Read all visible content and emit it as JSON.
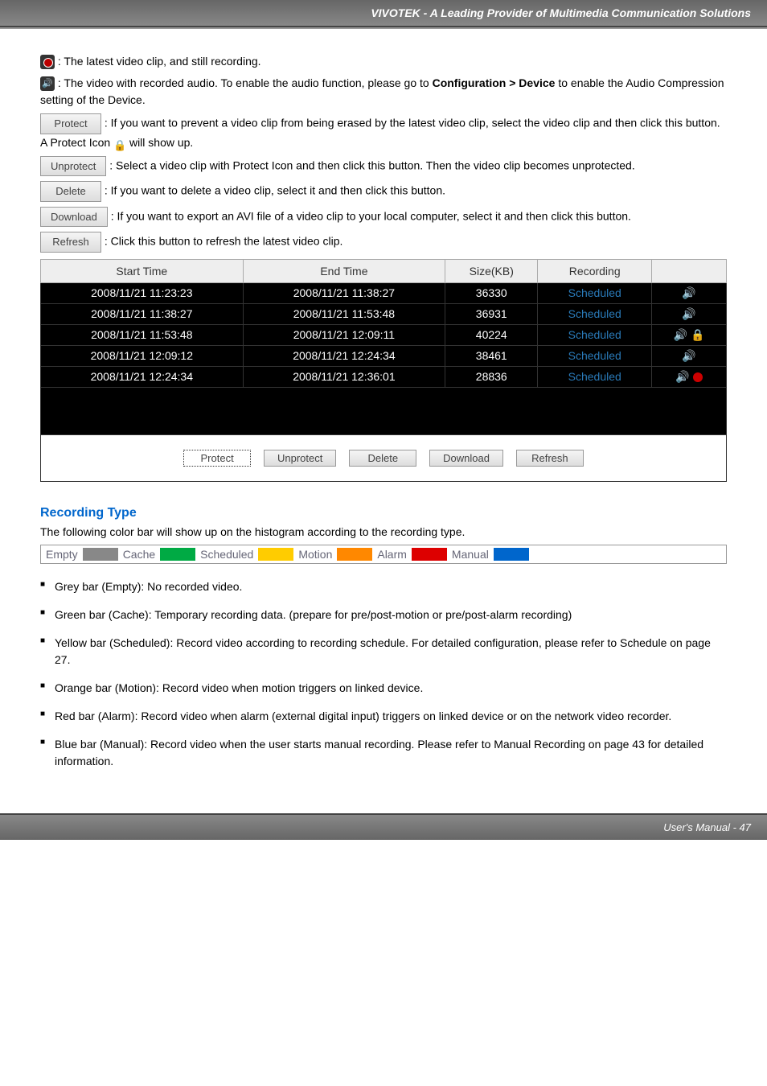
{
  "header": {
    "title": "VIVOTEK - A Leading Provider of Multimedia Communication Solutions"
  },
  "intro": {
    "rec": ": The latest video clip, and still recording.",
    "audio_a": " : The video with recorded audio. To enable the audio function, please go to ",
    "audio_b": "Configuration > Device",
    "audio_c": " to enable the Audio Compression setting of the Device."
  },
  "buttons": {
    "protect": "Protect",
    "unprotect": "Unprotect",
    "delete": "Delete",
    "download": "Download",
    "refresh": "Refresh"
  },
  "desc": {
    "protect_a": ":  If you want to prevent a video clip from being erased by the latest video clip, select the video clip and then click this button. A Protect Icon ",
    "protect_b": " will show up.",
    "unprotect": ": Select a video clip with Protect Icon and then click this button. Then the video clip becomes unprotected.",
    "delete": ": If you want to delete a video clip, select it and then click this button.",
    "download": ": If you want to export an AVI file of a video clip to your local computer, select it and then click this button.",
    "refresh": ": Click this button to refresh the latest video clip."
  },
  "table": {
    "headers": [
      "Start Time",
      "End Time",
      "Size(KB)",
      "Recording",
      ""
    ],
    "rows": [
      {
        "start": "2008/11/21 11:23:23",
        "end": "2008/11/21 11:38:27",
        "size": "36330",
        "rec": "Scheduled",
        "icons": "spk"
      },
      {
        "start": "2008/11/21 11:38:27",
        "end": "2008/11/21 11:53:48",
        "size": "36931",
        "rec": "Scheduled",
        "icons": "spk"
      },
      {
        "start": "2008/11/21 11:53:48",
        "end": "2008/11/21 12:09:11",
        "size": "40224",
        "rec": "Scheduled",
        "icons": "spklock"
      },
      {
        "start": "2008/11/21 12:09:12",
        "end": "2008/11/21 12:24:34",
        "size": "38461",
        "rec": "Scheduled",
        "icons": "spk"
      },
      {
        "start": "2008/11/21 12:24:34",
        "end": "2008/11/21 12:36:01",
        "size": "28836",
        "rec": "Scheduled",
        "icons": "spkrec"
      }
    ]
  },
  "rectype": {
    "title": "Recording Type",
    "intro": "The following color bar will show up on the histogram according to the recording type.",
    "legend": {
      "empty": "Empty",
      "cache": "Cache",
      "scheduled": "Scheduled",
      "motion": "Motion",
      "alarm": "Alarm",
      "manual": "Manual"
    }
  },
  "bullets": {
    "b1": "Grey bar (Empty): No recorded video.",
    "b2": "Green bar (Cache): Temporary recording data. (prepare for pre/post-motion or pre/post-alarm recording)",
    "b3": "Yellow bar (Scheduled): Record video according to recording schedule. For detailed configuration, please refer to Schedule on page 27.",
    "b4": "Orange bar (Motion): Record video when motion triggers on linked device.",
    "b5": "Red bar (Alarm): Record video when alarm (external digital input) triggers on linked device or on the network video recorder.",
    "b6": "Blue bar (Manual): Record video when the user starts manual recording. Please refer to Manual Recording on page 43 for detailed information."
  },
  "footer": {
    "text": "User's Manual - 47"
  }
}
